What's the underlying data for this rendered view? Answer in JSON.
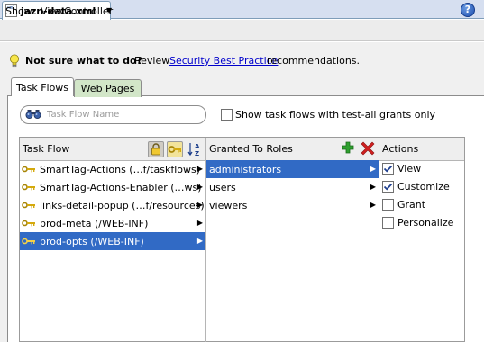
{
  "editor": {
    "tab_label": "jazn-data.xml",
    "file_icon_text": "xml"
  },
  "showbar": {
    "label": "Show:",
    "value": "ViewController",
    "arrow": "▼",
    "help": "?"
  },
  "hint": {
    "bold": "Not sure what to do?",
    "review": "Review",
    "link": "Security Best Practice",
    "tail": "recommendations."
  },
  "tabs": [
    {
      "label": "Task Flows",
      "active": true
    },
    {
      "label": "Web Pages",
      "active": false
    }
  ],
  "search": {
    "placeholder": "Task Flow Name"
  },
  "show_all": {
    "label": "Show task flows with test-all grants only",
    "checked": false
  },
  "task_flow_column": {
    "header": "Task Flow",
    "sort_icon_text": "A\nZ",
    "rows": [
      {
        "label": "SmartTag-Actions (…f/taskflows)",
        "selected": false
      },
      {
        "label": "SmartTag-Actions-Enabler (…ws)",
        "selected": false
      },
      {
        "label": "links-detail-popup (…f/resources)",
        "selected": false
      },
      {
        "label": "prod-meta (/WEB-INF)",
        "selected": false
      },
      {
        "label": "prod-opts (/WEB-INF)",
        "selected": true
      }
    ]
  },
  "roles_column": {
    "header": "Granted To Roles",
    "rows": [
      {
        "label": "administrators",
        "selected": true
      },
      {
        "label": "users",
        "selected": false
      },
      {
        "label": "viewers",
        "selected": false
      }
    ]
  },
  "actions_column": {
    "header": "Actions",
    "items": [
      {
        "label": "View",
        "checked": true
      },
      {
        "label": "Customize",
        "checked": true
      },
      {
        "label": "Grant",
        "checked": false
      },
      {
        "label": "Personalize",
        "checked": false
      }
    ]
  },
  "row_arrow": "▶",
  "colors": {
    "selection": "#316ac5",
    "link": "#0000cc",
    "key_icon": "#e8c21e",
    "add": "#2ea02e",
    "delete": "#d02020"
  }
}
